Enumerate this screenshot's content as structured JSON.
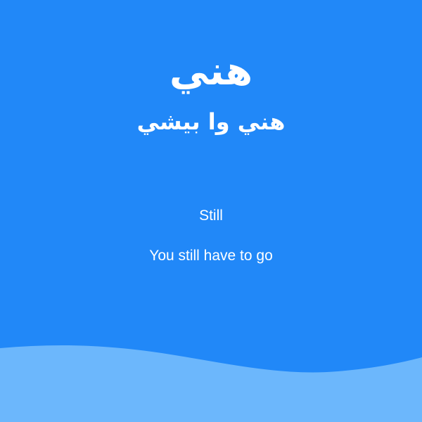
{
  "card": {
    "word": "هني",
    "transliteration": "هني وا بيشي",
    "meaning": "Still",
    "example": "You still have to go"
  },
  "colors": {
    "background": "#2188f8",
    "wave": "#6cb7fc",
    "text": "#ffffff"
  }
}
